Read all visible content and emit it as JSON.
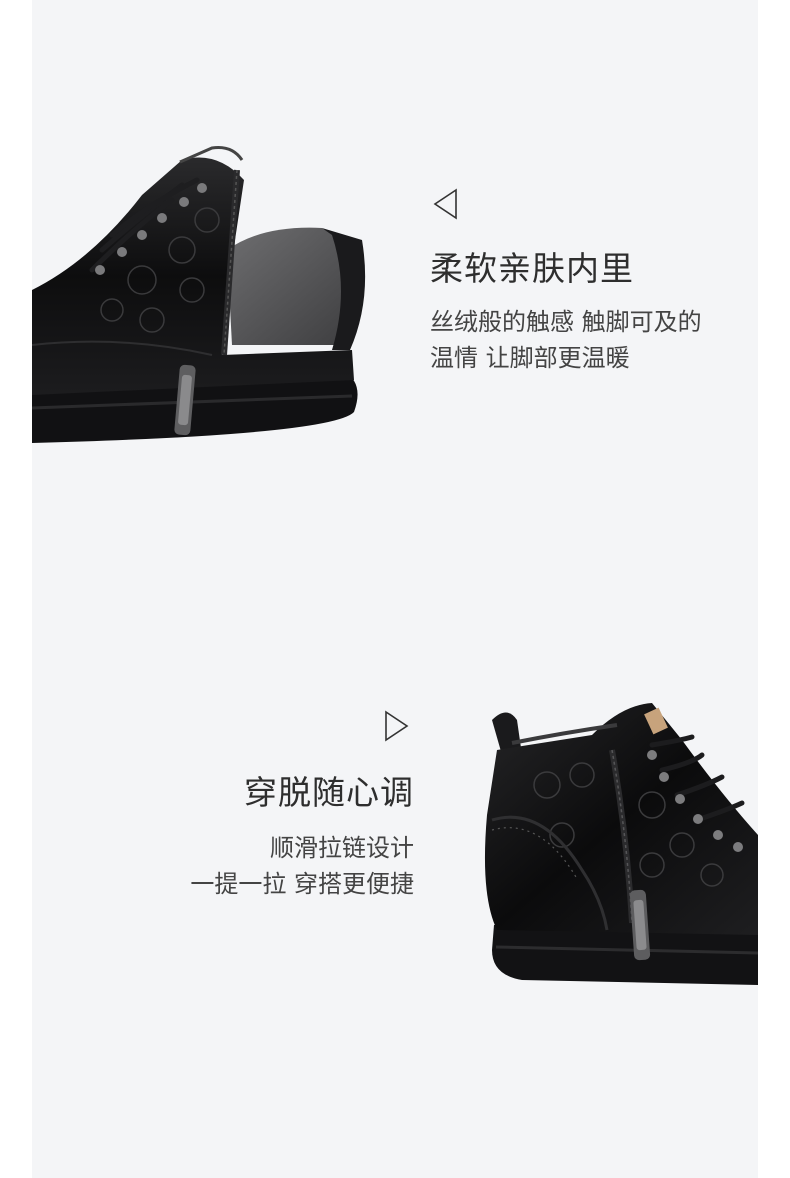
{
  "section1": {
    "title": "柔软亲肤内里",
    "lines": [
      "丝绒般的触感 触脚可及的",
      "温情 让脚部更温暖"
    ],
    "arrow": "triangle-left-outline"
  },
  "section2": {
    "title": "穿脱随心调",
    "lines": [
      "顺滑拉链设计",
      "一提一拉 穿搭更便捷"
    ],
    "arrow": "triangle-right-outline"
  },
  "colors": {
    "panel": "#f4f5f7",
    "leather": "#0c0c0d",
    "lining": "#5a5a5c"
  }
}
